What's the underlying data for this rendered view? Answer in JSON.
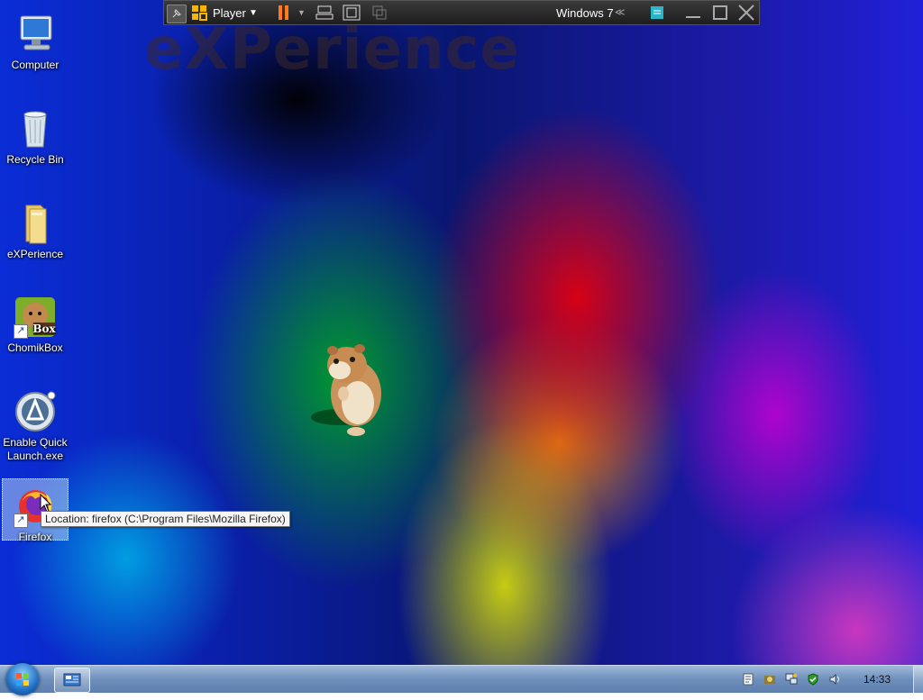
{
  "wallpaper": {
    "watermark_text": "eXPerience"
  },
  "desktop_icons": [
    {
      "label": "Computer",
      "icon": "computer-icon"
    },
    {
      "label": "Recycle Bin",
      "icon": "recycle-bin-icon"
    },
    {
      "label": "eXPerience",
      "icon": "folder-icon"
    },
    {
      "label": "ChomikBox",
      "icon": "chomikbox-icon",
      "badge": "Box"
    },
    {
      "label": "Enable Quick Launch.exe",
      "icon": "quick-launch-icon"
    },
    {
      "label": "Firefox",
      "icon": "firefox-icon",
      "selected": true
    }
  ],
  "tooltip": {
    "text": "Location: firefox (C:\\Program Files\\Mozilla Firefox)"
  },
  "vm_toolbar": {
    "player_label": "Player",
    "vm_name": "Windows 7",
    "icons": [
      "pin-icon",
      "player-logo-icon",
      "dropdown-icon",
      "pause-icon",
      "ctrl-alt-del-icon",
      "fullscreen-icon",
      "unity-icon",
      "library-icon",
      "minimize-icon",
      "restore-icon",
      "close-icon"
    ],
    "accent_color": "#ff7a1a"
  },
  "taskbar": {
    "start_button": "start-orb-icon",
    "pinned_app": "control-panel-icon",
    "tray_icons": [
      "document-icon",
      "tools-icon",
      "network-icon",
      "security-icon",
      "volume-icon"
    ],
    "clock": "14:33"
  }
}
